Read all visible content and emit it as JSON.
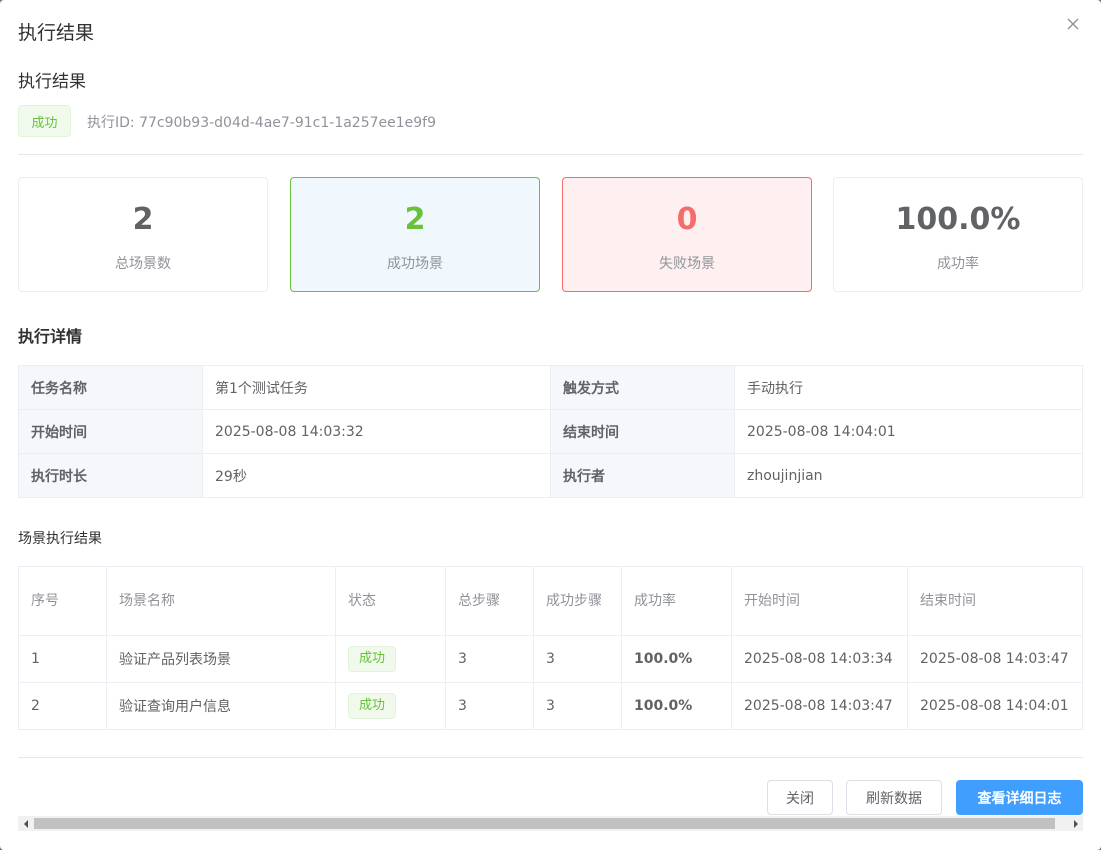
{
  "dialog": {
    "title": "执行结果",
    "section_title": "执行结果",
    "status_tag": "成功",
    "execution_id": "执行ID: 77c90b93-d04d-4ae7-91c1-1a257ee1e9f9"
  },
  "stats": [
    {
      "value": "2",
      "label": "总场景数"
    },
    {
      "value": "2",
      "label": "成功场景"
    },
    {
      "value": "0",
      "label": "失败场景"
    },
    {
      "value": "100.0%",
      "label": "成功率"
    }
  ],
  "details": {
    "title": "执行详情",
    "rows": [
      {
        "k1": "任务名称",
        "v1": "第1个测试任务",
        "k2": "触发方式",
        "v2": "手动执行"
      },
      {
        "k1": "开始时间",
        "v1": "2025-08-08 14:03:32",
        "k2": "结束时间",
        "v2": "2025-08-08 14:04:01"
      },
      {
        "k1": "执行时长",
        "v1": "29秒",
        "k2": "执行者",
        "v2": "zhoujinjian"
      }
    ]
  },
  "scenes": {
    "title": "场景执行结果",
    "columns": [
      "序号",
      "场景名称",
      "状态",
      "总步骤",
      "成功步骤",
      "成功率",
      "开始时间",
      "结束时间"
    ],
    "rows": [
      {
        "index": "1",
        "name": "验证产品列表场景",
        "status": "成功",
        "total_steps": "3",
        "success_steps": "3",
        "rate": "100.0%",
        "start": "2025-08-08 14:03:34",
        "end": "2025-08-08 14:03:47"
      },
      {
        "index": "2",
        "name": "验证查询用户信息",
        "status": "成功",
        "total_steps": "3",
        "success_steps": "3",
        "rate": "100.0%",
        "start": "2025-08-08 14:03:47",
        "end": "2025-08-08 14:04:01"
      }
    ]
  },
  "footer": {
    "close_label": "关闭",
    "refresh_label": "刷新数据",
    "view_log_label": "查看详细日志"
  },
  "colors": {
    "success": "#67c23a",
    "danger": "#f56c6c",
    "primary": "#409eff"
  }
}
